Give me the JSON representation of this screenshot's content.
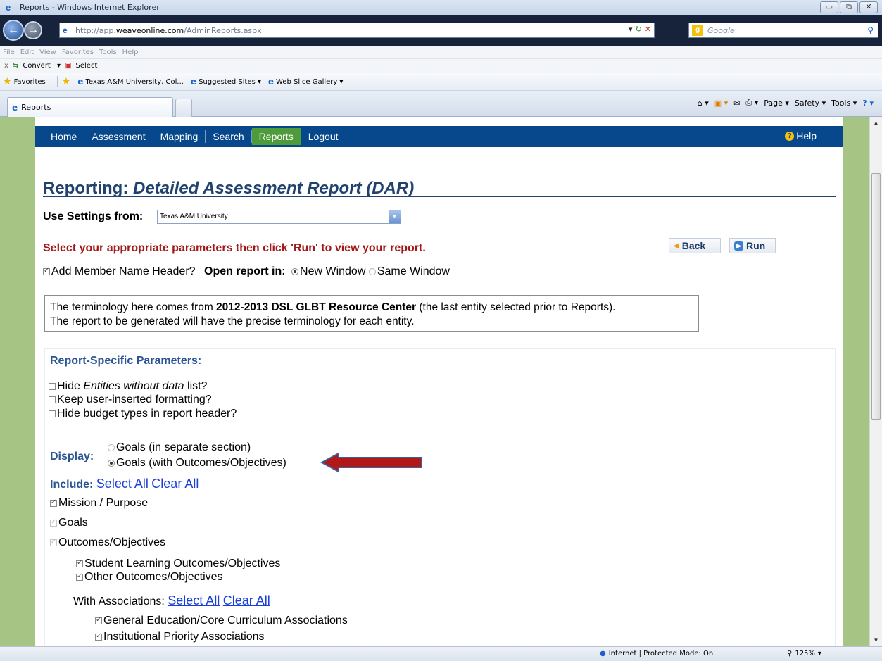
{
  "window": {
    "title": "Reports - Windows Internet Explorer",
    "controls": [
      "▭",
      "⧉",
      "✕"
    ]
  },
  "address": {
    "url_prefix": "http://app.",
    "url_domain": "weaveonline.com",
    "url_path": "/AdminReports.aspx",
    "search_placeholder": "Google"
  },
  "menu": [
    "File",
    "Edit",
    "View",
    "Favorites",
    "Tools",
    "Help"
  ],
  "command_bar": {
    "close": "x",
    "convert": "Convert",
    "select": "Select"
  },
  "favorites": {
    "label": "Favorites",
    "items": [
      "Texas A&M University, Col...",
      "Suggested Sites",
      "Web Slice Gallery"
    ]
  },
  "tab": {
    "label": "Reports"
  },
  "tools": {
    "page": "Page",
    "safety": "Safety",
    "tools": "Tools"
  },
  "nav": {
    "items": [
      "Home",
      "Assessment",
      "Mapping",
      "Search",
      "Reports",
      "Logout"
    ],
    "active": "Reports",
    "help": "Help"
  },
  "page": {
    "title_prefix": "Reporting: ",
    "title_italic": "Detailed Assessment Report (DAR)",
    "settings_label": "Use Settings from:",
    "settings_value": "Texas A&M University",
    "instruction": "Select your appropriate parameters then click 'Run' to view your report.",
    "back_label": "Back",
    "run_label": "Run",
    "member_header_label": "Add Member Name Header?",
    "open_in_label": "Open report in:",
    "open_new": "New Window",
    "open_same": "Same Window",
    "terminology_line1_a": "The terminology here comes from ",
    "terminology_line1_b": "2012-2013 DSL GLBT Resource Center",
    "terminology_line1_c": " (the last entity selected prior to Reports).",
    "terminology_line2": "The report to be generated will have the precise terminology for each entity."
  },
  "params": {
    "heading": "Report-Specific Parameters:",
    "hide_entities_a": "Hide ",
    "hide_entities_b": "Entities without data",
    "hide_entities_c": " list?",
    "keep_formatting": "Keep user-inserted formatting?",
    "hide_budget": "Hide budget types in report header?",
    "display_label": "Display:",
    "display_opt1": "Goals (in separate section)",
    "display_opt2": "Goals (with Outcomes/Objectives)",
    "include_label": "Include:",
    "select_all": "Select All",
    "clear_all": "Clear All",
    "mission": "Mission / Purpose",
    "goals": "Goals",
    "outcomes": "Outcomes/Objectives",
    "slo": "Student Learning Outcomes/Objectives",
    "other_outcomes": "Other Outcomes/Objectives",
    "with_assoc_label": "With Associations:",
    "gen_ed": "General Education/Core Curriculum Associations",
    "inst_priority": "Institutional Priority Associations"
  },
  "status": {
    "zone": "Internet | Protected Mode: On",
    "zoom": "125%"
  }
}
